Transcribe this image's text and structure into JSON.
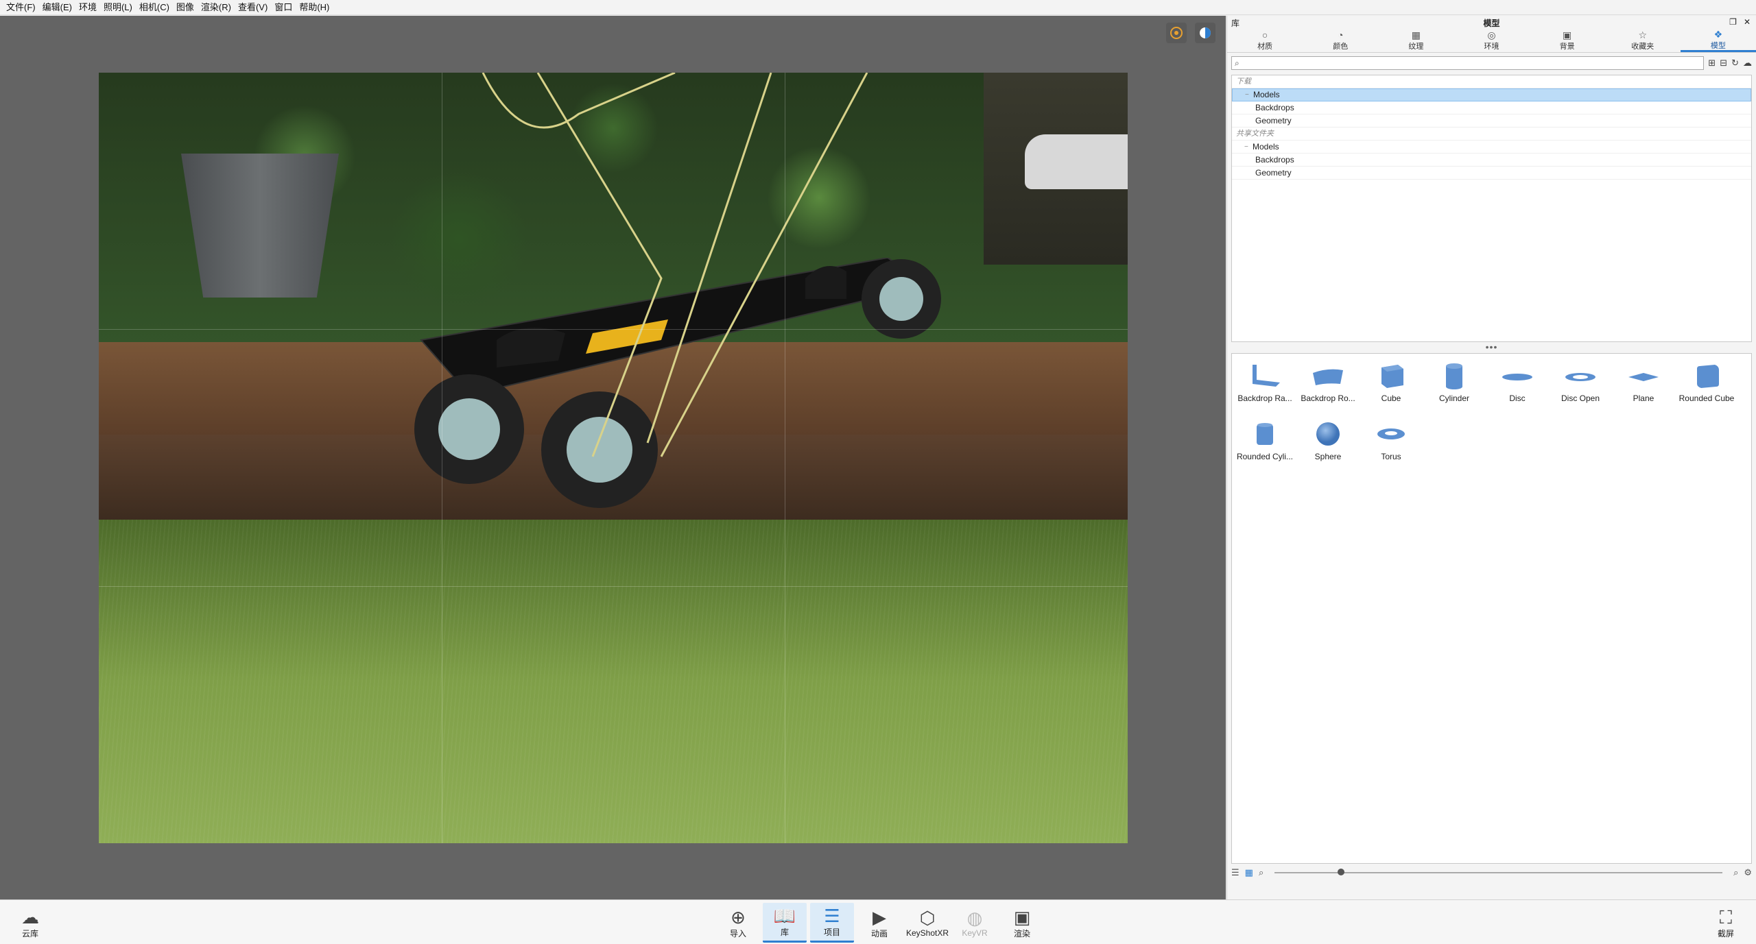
{
  "menu": {
    "items": [
      "文件(F)",
      "编辑(E)",
      "环境",
      "照明(L)",
      "相机(C)",
      "图像",
      "渲染(R)",
      "查看(V)",
      "窗口",
      "帮助(H)"
    ]
  },
  "library": {
    "panel_label": "库",
    "title": "模型",
    "tabs": [
      {
        "label": "材质",
        "icon": "sphere-icon"
      },
      {
        "label": "颜色",
        "icon": "palette-icon"
      },
      {
        "label": "纹理",
        "icon": "checker-icon"
      },
      {
        "label": "环境",
        "icon": "globe-icon"
      },
      {
        "label": "背景",
        "icon": "image-icon"
      },
      {
        "label": "收藏夹",
        "icon": "star-icon"
      },
      {
        "label": "模型",
        "icon": "cubes-icon",
        "active": true
      }
    ],
    "search": {
      "value": "",
      "placeholder": ""
    },
    "tree": {
      "section1": "下载",
      "models": "Models",
      "backdrops": "Backdrops",
      "geometry": "Geometry",
      "section2": "共享文件夹",
      "models2": "Models",
      "backdrops2": "Backdrops",
      "geometry2": "Geometry"
    },
    "models": [
      {
        "label": "Backdrop Ra...",
        "icon": "backdrop-icon"
      },
      {
        "label": "Backdrop Ro...",
        "icon": "backdrop-round-icon"
      },
      {
        "label": "Cube",
        "icon": "cube-icon"
      },
      {
        "label": "Cylinder",
        "icon": "cylinder-icon"
      },
      {
        "label": "Disc",
        "icon": "disc-icon"
      },
      {
        "label": "Disc Open",
        "icon": "disc-open-icon"
      },
      {
        "label": "Plane",
        "icon": "plane-icon"
      },
      {
        "label": "Rounded Cube",
        "icon": "rounded-cube-icon"
      },
      {
        "label": "Rounded Cyli...",
        "icon": "rounded-cylinder-icon"
      },
      {
        "label": "Sphere",
        "icon": "sphere-model-icon"
      },
      {
        "label": "Torus",
        "icon": "torus-icon"
      }
    ],
    "thumbnail_size": 0.14
  },
  "bottombar": {
    "cloud": "云库",
    "import": "导入",
    "library": "库",
    "project": "项目",
    "animation": "动画",
    "keyshotxr": "KeyShotXR",
    "keyvr": "KeyVR",
    "render": "渲染",
    "screenshot": "截屏"
  },
  "colors": {
    "accent": "#2f7fd0",
    "viewport_bg": "#646464",
    "model_blue": "#5b8fd0"
  }
}
